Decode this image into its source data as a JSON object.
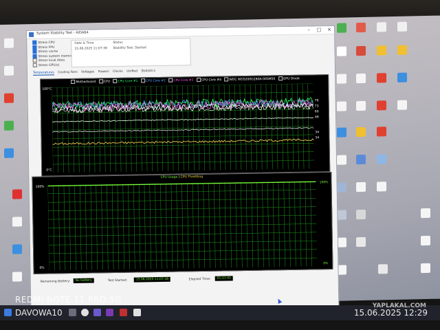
{
  "window": {
    "title": "System Stability Test - AIDA64"
  },
  "stress_options": [
    {
      "label": "Stress CPU",
      "checked": true
    },
    {
      "label": "Stress FPU",
      "checked": true
    },
    {
      "label": "Stress cache",
      "checked": true
    },
    {
      "label": "Stress system memory",
      "checked": true
    },
    {
      "label": "Stress local disks",
      "checked": false
    },
    {
      "label": "Stress GPU(s)",
      "checked": false
    }
  ],
  "info": {
    "date_header": "Date & Time",
    "status_header": "Status",
    "date_value": "15.06.2025 11:07:38",
    "status_value": "Stability Test: Started"
  },
  "tabs": [
    "Temperatures",
    "Cooling Fans",
    "Voltages",
    "Powers",
    "Clocks",
    "Unified",
    "Statistics"
  ],
  "temp_chart": {
    "ymax_label": "100°C",
    "ymin_label": "0°C",
    "right_labels": [
      "79",
      "73",
      "60",
      "48",
      "34",
      "34"
    ],
    "legend": [
      {
        "name": "Motherboard",
        "color": "#ffffff"
      },
      {
        "name": "CPU",
        "color": "#ffffff"
      },
      {
        "name": "CPU Core #1",
        "color": "#2dff6b"
      },
      {
        "name": "CPU Core #2",
        "color": "#5aa8ff"
      },
      {
        "name": "CPU Core #3",
        "color": "#ff5cf0"
      },
      {
        "name": "CPU Core #4",
        "color": "#ffffff"
      },
      {
        "name": "WDC WDS200G2B0A-00SM50",
        "color": "#ffffff"
      },
      {
        "name": "GPU Diode",
        "color": "#ffffff"
      }
    ]
  },
  "usage_chart": {
    "legend_usage": "CPU Usage",
    "legend_sep": "|",
    "legend_throttle": "CPU Throttling",
    "ymax_left": "100%",
    "ymin_left": "0%",
    "ymax_right": "100%",
    "ymin_right": "0%"
  },
  "bottom": {
    "battery_label": "Remaining Battery:",
    "battery_value": "No battery",
    "started_label": "Test Started:",
    "started_value": "15.06.2025 11:07:38",
    "elapsed_label": "Elapsed Time:",
    "elapsed_value": "01:21:41"
  },
  "taskbar": {
    "date": "15.06.2025",
    "time": "12:29"
  },
  "photo_overlay": {
    "device": "REDMI NOTE 11 PRO 5G",
    "user": "DAVOWA10",
    "timestamp": "15.06.2025 12:29",
    "site": "YAPLAKAL.COM"
  },
  "colors": {
    "chart_bg": "#000000",
    "grid": "#1f9a1f",
    "usage_line": "#7dff3c"
  }
}
